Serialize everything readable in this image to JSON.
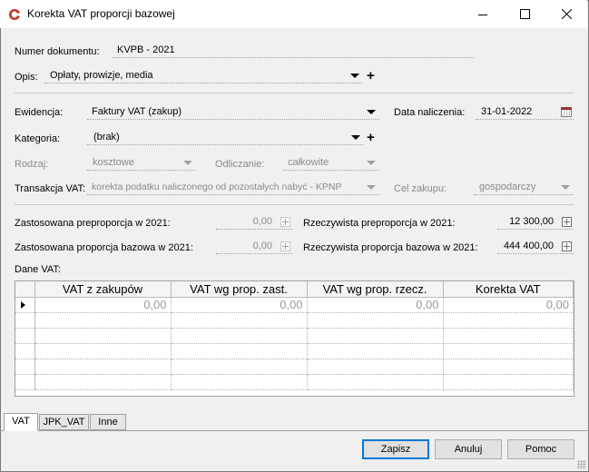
{
  "window": {
    "title": "Korekta VAT proporcji bazowej",
    "icon": "comarch-logo-icon"
  },
  "header": {
    "doc_number_label": "Numer dokumentu:",
    "doc_number_value": "KVPB - 2021",
    "desc_label": "Opis:",
    "desc_value": "Opłaty, prowizje, media"
  },
  "fields": {
    "ewidencja_label": "Ewidencja:",
    "ewidencja_value": "Faktury VAT (zakup)",
    "data_label": "Data naliczenia:",
    "data_value": "31-01-2022",
    "kategoria_label": "Kategoria:",
    "kategoria_value": "(brak)",
    "rodzaj_label": "Rodzaj:",
    "rodzaj_value": "kosztowe",
    "odliczanie_label": "Odliczanie:",
    "odliczanie_value": "całkowite",
    "transakcja_label": "Transakcja VAT:",
    "transakcja_value": "korekta podatku naliczonego od pozostałych nabyć - KPNP",
    "cel_label": "Cel zakupu:",
    "cel_value": "gospodarczy"
  },
  "proportions": {
    "zast_pre_label": "Zastosowana preproporcja w 2021:",
    "zast_pre_value": "0,00",
    "rzecz_pre_label": "Rzeczywista preproporcja w 2021:",
    "rzecz_pre_value": "12 300,00",
    "zast_baz_label": "Zastosowana proporcja bazowa w 2021:",
    "zast_baz_value": "0,00",
    "rzecz_baz_label": "Rzeczywista proporcja bazowa w 2021:",
    "rzecz_baz_value": "444 400,00"
  },
  "vat_grid": {
    "label": "Dane VAT:",
    "columns": [
      "VAT z zakupów",
      "VAT wg prop. zast.",
      "VAT wg prop. rzecz.",
      "Korekta VAT"
    ],
    "rows": [
      [
        "0,00",
        "0,00",
        "0,00",
        "0,00"
      ]
    ],
    "empty_rows": 5
  },
  "tabs": [
    "VAT",
    "JPK_VAT",
    "Inne"
  ],
  "buttons": {
    "save": "Zapisz",
    "cancel": "Anuluj",
    "help": "Pomoc"
  },
  "colors": {
    "accent": "#0078d7",
    "logo": "#c0392b"
  }
}
